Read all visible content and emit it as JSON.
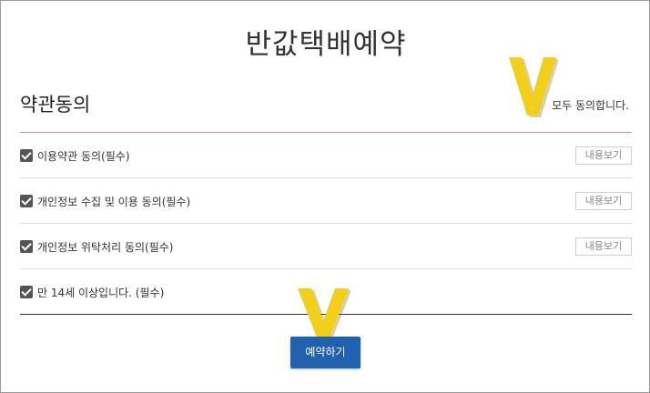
{
  "page": {
    "title": "반값택배예약"
  },
  "section": {
    "title": "약관동의",
    "agree_all_label": "모두 동의합니다."
  },
  "terms": [
    {
      "label": "이용약관 동의(필수)",
      "checked": true,
      "view_label": "내용보기"
    },
    {
      "label": "개인정보 수집 및 이용 동의(필수)",
      "checked": true,
      "view_label": "내용보기"
    },
    {
      "label": "개인정보 위탁처리 동의(필수)",
      "checked": true,
      "view_label": "내용보기"
    },
    {
      "label": "만 14세 이상입니다. (필수)",
      "checked": true
    }
  ],
  "submit": {
    "label": "예약하기"
  },
  "annotation": {
    "mark": "V",
    "color": "#f2cf1a"
  },
  "colors": {
    "accent": "#2062ae",
    "divider_red": "#d98a84",
    "checkbox": "#555555"
  }
}
